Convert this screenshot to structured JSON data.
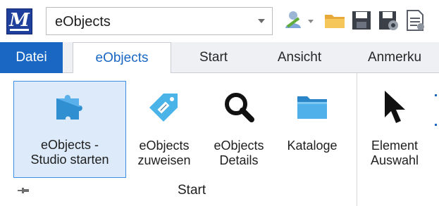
{
  "quick_access": {
    "workspace_value": "eObjects",
    "icons": [
      "app-logo-icon",
      "user-icon",
      "open-folder-icon",
      "save-icon",
      "save-settings-icon",
      "document-icon"
    ]
  },
  "app_logo_text": "M",
  "tabs": [
    {
      "label": "Datei",
      "state": "file"
    },
    {
      "label": "eObjects",
      "state": "active"
    },
    {
      "label": "Start",
      "state": "normal"
    },
    {
      "label": "Ansicht",
      "state": "normal"
    },
    {
      "label": "Anmerku",
      "state": "normal"
    }
  ],
  "ribbon": {
    "group_start_label": "Start",
    "buttons": [
      {
        "line1": "eObjects -",
        "line2": "Studio starten",
        "icon": "puzzle-icon",
        "selected": true
      },
      {
        "line1": "eObjects",
        "line2": "zuweisen",
        "icon": "tag-icon",
        "selected": false
      },
      {
        "line1": "eObjects",
        "line2": "Details",
        "icon": "magnifier-icon",
        "selected": false
      },
      {
        "line1": "Kataloge",
        "line2": "",
        "icon": "folder-icon",
        "selected": false
      },
      {
        "line1": "Element",
        "line2": "Auswahl",
        "icon": "arrow-pointer-icon",
        "selected": false
      }
    ]
  },
  "colors": {
    "accent": "#1967c2",
    "selected_bg": "#dceaf9",
    "selected_border": "#3d8ee0",
    "puzzle": "#2f8fd1",
    "tag": "#4ab3e8",
    "folder": "#3a9ee0"
  }
}
